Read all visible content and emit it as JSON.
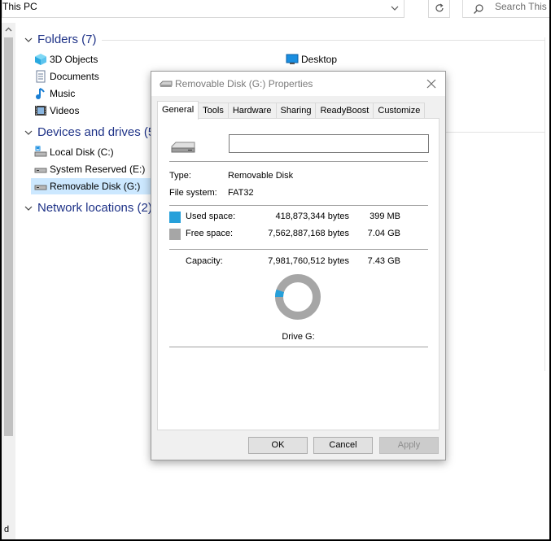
{
  "address": {
    "path": "This PC"
  },
  "search": {
    "placeholder": "Search This P"
  },
  "groups": {
    "folders": "Folders (7)",
    "devices": "Devices and drives (5",
    "network": "Network locations (2)"
  },
  "folders": [
    "3D Objects",
    "Documents",
    "Music",
    "Videos",
    "Desktop"
  ],
  "drives": [
    "Local Disk (C:)",
    "System Reserved (E:)",
    "Removable Disk (G:)"
  ],
  "dialog": {
    "title": "Removable Disk (G:) Properties",
    "tabs": [
      "General",
      "Tools",
      "Hardware",
      "Sharing",
      "ReadyBoost",
      "Customize"
    ],
    "name_value": "",
    "type_label": "Type:",
    "type_value": "Removable Disk",
    "fs_label": "File system:",
    "fs_value": "FAT32",
    "used_label": "Used space:",
    "used_bytes": "418,873,344 bytes",
    "used_size": "399 MB",
    "free_label": "Free space:",
    "free_bytes": "7,562,887,168 bytes",
    "free_size": "7.04 GB",
    "cap_label": "Capacity:",
    "cap_bytes": "7,981,760,512 bytes",
    "cap_size": "7.43 GB",
    "drive_label": "Drive G:",
    "used_fraction": 0.0525,
    "used_color": "#26a0da",
    "free_color": "#a6a6a6",
    "ok": "OK",
    "cancel": "Cancel",
    "apply": "Apply"
  },
  "bottom_text": "d"
}
